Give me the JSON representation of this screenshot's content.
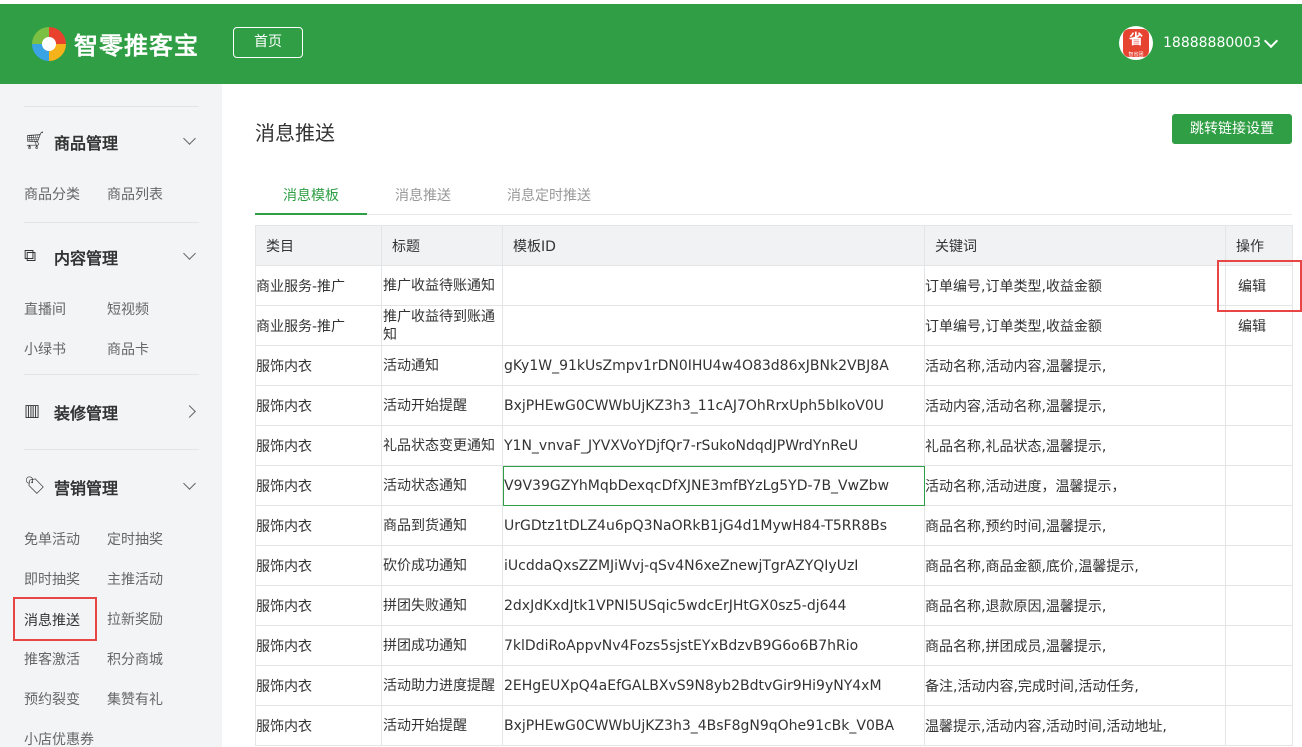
{
  "header": {
    "brand": "智零推客宝",
    "home_label": "首页",
    "avatar_text": "省",
    "avatar_sub": "智省团",
    "phone": "18888880003"
  },
  "sidebar": {
    "groups": [
      {
        "title": "商品管理",
        "icon": "cart-icon",
        "items": [
          "商品分类",
          "商品列表"
        ]
      },
      {
        "title": "内容管理",
        "icon": "copy-icon",
        "items": [
          "直播间",
          "短视频",
          "小绿书",
          "商品卡"
        ]
      },
      {
        "title": "装修管理",
        "icon": "bar-chart-icon",
        "items": []
      },
      {
        "title": "营销管理",
        "icon": "tag-icon",
        "items": [
          "免单活动",
          "定时抽奖",
          "即时抽奖",
          "主推活动",
          "消息推送",
          "拉新奖励",
          "推客激活",
          "积分商城",
          "预约裂变",
          "集赞有礼",
          "小店优惠券"
        ]
      }
    ]
  },
  "main": {
    "title": "消息推送",
    "action_button": "跳转链接设置",
    "tabs": [
      "消息模板",
      "消息推送",
      "消息定时推送"
    ],
    "table": {
      "headers": [
        "类目",
        "标题",
        "模板ID",
        "关键词",
        "操作"
      ],
      "rows": [
        [
          "商业服务-推广",
          "推广收益待账通知",
          "",
          "订单编号,订单类型,收益金额",
          "编辑"
        ],
        [
          "商业服务-推广",
          "推广收益待到账通知",
          "",
          "订单编号,订单类型,收益金额",
          "编辑"
        ],
        [
          "服饰内衣",
          "活动通知",
          "gKy1W_91kUsZmpv1rDN0IHU4w4O83d86xJBNk2VBJ8A",
          "活动名称,活动内容,温馨提示,",
          ""
        ],
        [
          "服饰内衣",
          "活动开始提醒",
          "BxjPHEwG0CWWbUjKZ3h3_11cAJ7OhRrxUph5bIkoV0U",
          "活动内容,活动名称,温馨提示,",
          ""
        ],
        [
          "服饰内衣",
          "礼品状态变更通知",
          "Y1N_vnvaF_JYVXVoYDjfQr7-rSukoNdqdJPWrdYnReU",
          "礼品名称,礼品状态,温馨提示,",
          ""
        ],
        [
          "服饰内衣",
          "活动状态通知",
          "V9V39GZYhMqbDexqcDfXJNE3mfBYzLg5YD-7B_VwZbw",
          "活动名称,活动进度，温馨提示，",
          ""
        ],
        [
          "服饰内衣",
          "商品到货通知",
          "UrGDtz1tDLZ4u6pQ3NaORkB1jG4d1MywH84-T5RR8Bs",
          "商品名称,预约时间,温馨提示,",
          ""
        ],
        [
          "服饰内衣",
          "砍价成功通知",
          "iUcddaQxsZZMJiWvj-qSv4N6xeZnewjTgrAZYQIyUzI",
          "商品名称,商品金额,底价,温馨提示,",
          ""
        ],
        [
          "服饰内衣",
          "拼团失败通知",
          "2dxJdKxdJtk1VPNI5USqic5wdcErJHtGX0sz5-dj644",
          "商品名称,退款原因,温馨提示,",
          ""
        ],
        [
          "服饰内衣",
          "拼团成功通知",
          "7klDdiRoAppvNv4Fozs5sjstEYxBdzvB9G6o6B7hRio",
          "商品名称,拼团成员,温馨提示,",
          ""
        ],
        [
          "服饰内衣",
          "活动助力进度提醒",
          "2EHgEUXpQ4aEfGALBXvS9N8yb2BdtvGir9Hi9yNY4xM",
          "备注,活动内容,完成时间,活动任务,",
          ""
        ],
        [
          "服饰内衣",
          "活动开始提醒",
          "BxjPHEwG0CWWbUjKZ3h3_4BsF8gN9qOhe91cBk_V0BA",
          "温馨提示,活动内容,活动时间,活动地址,",
          ""
        ]
      ]
    }
  },
  "colors": {
    "brand_green": "#2f9e44",
    "highlight_red": "#e84545"
  }
}
